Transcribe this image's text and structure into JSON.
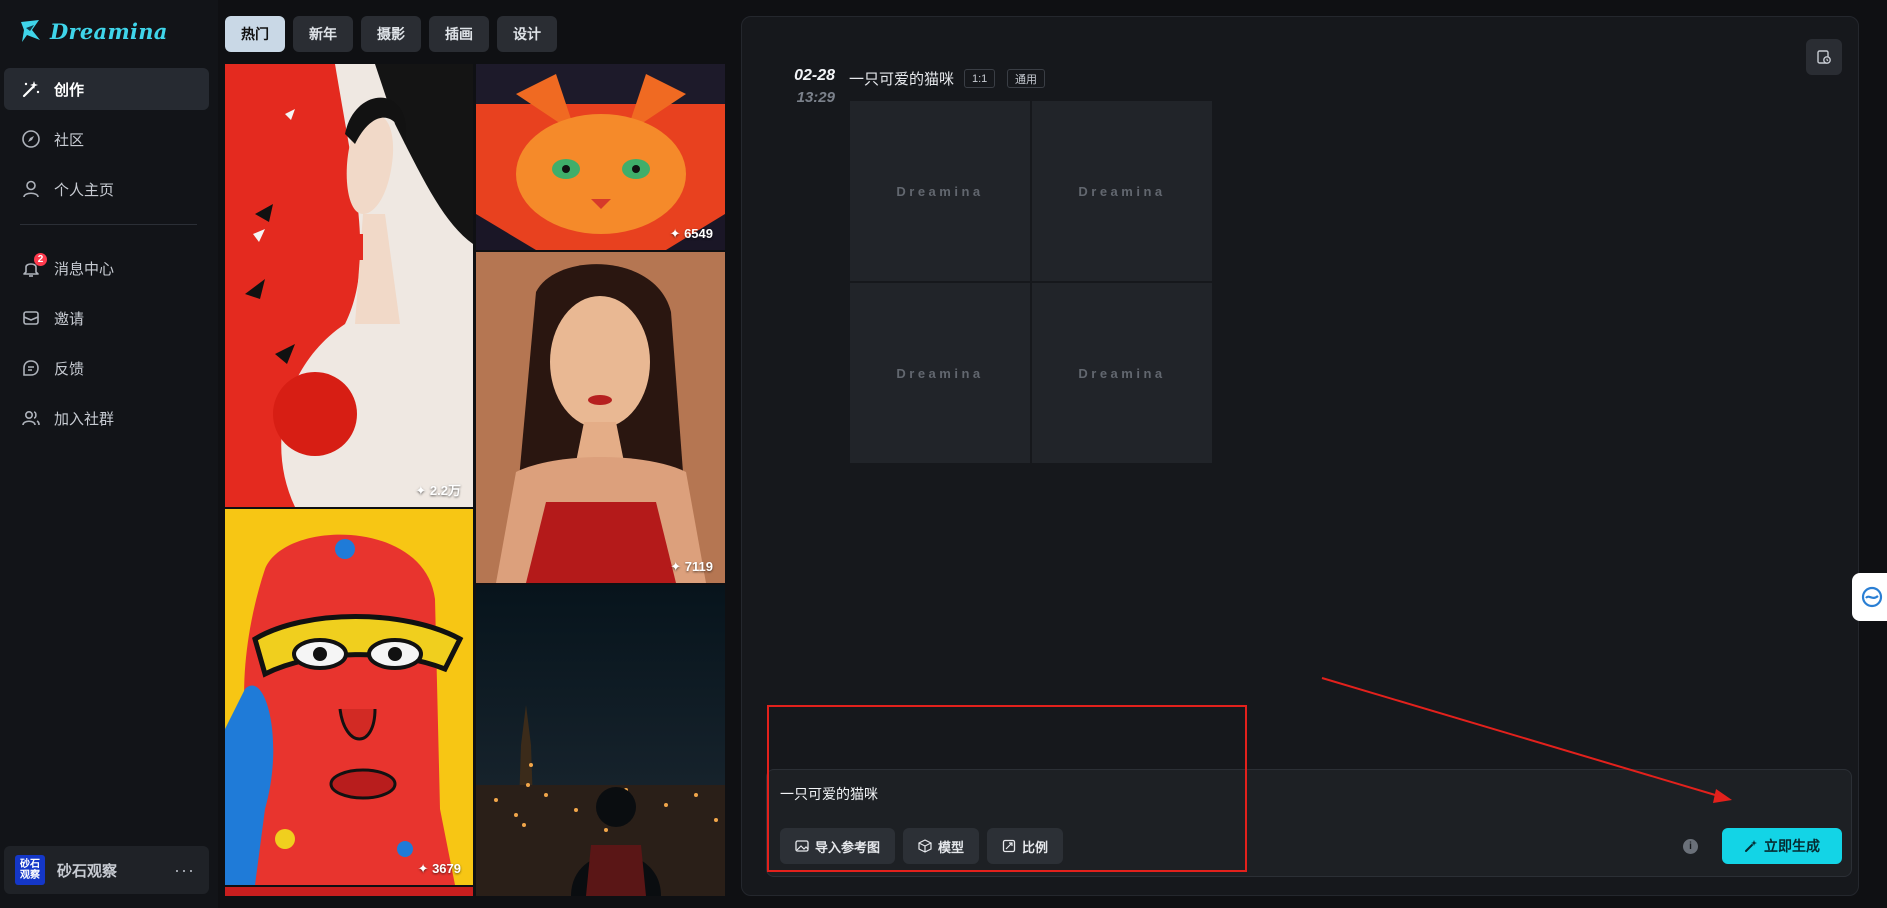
{
  "app": {
    "logo_text": "Dreamina"
  },
  "sidebar": {
    "items": [
      {
        "label": "创作",
        "icon": "magic-wand-icon",
        "active": true
      },
      {
        "label": "社区",
        "icon": "compass-icon"
      },
      {
        "label": "个人主页",
        "icon": "user-icon"
      }
    ],
    "items2": [
      {
        "label": "消息中心",
        "icon": "bell-icon",
        "badge": "2"
      },
      {
        "label": "邀请",
        "icon": "mail-icon"
      },
      {
        "label": "反馈",
        "icon": "feedback-icon"
      },
      {
        "label": "加入社群",
        "icon": "group-icon"
      }
    ],
    "user": {
      "avatar_text": "砂石观察",
      "name": "砂石观察",
      "more": "···"
    }
  },
  "tabs": [
    {
      "label": "热门",
      "active": true
    },
    {
      "label": "新年"
    },
    {
      "label": "摄影"
    },
    {
      "label": "插画"
    },
    {
      "label": "设计"
    }
  ],
  "gallery": {
    "tiles": [
      {
        "likes": "2.2万",
        "subject": "woman-red-wings"
      },
      {
        "likes": "6549",
        "subject": "cat-poster"
      },
      {
        "likes": "7119",
        "subject": "woman-red-dress"
      },
      {
        "likes": "3679",
        "subject": "pop-art-face"
      },
      {
        "likes": "",
        "subject": "city-night"
      }
    ]
  },
  "record": {
    "date": "02-28",
    "time": "13:29",
    "prompt": "一只可爱的猫咪",
    "ratio_tag": "1:1",
    "model_tag": "通用",
    "placeholder": "Dreamina"
  },
  "input": {
    "text": "一只可爱的猫咪",
    "buttons": {
      "ref": "导入参考图",
      "model": "模型",
      "ratio": "比例"
    },
    "info": "i",
    "generate": "立即生成"
  },
  "colors": {
    "accent": "#13d4e6",
    "annotation": "#e3211c",
    "badge": "#ff3b4e"
  }
}
